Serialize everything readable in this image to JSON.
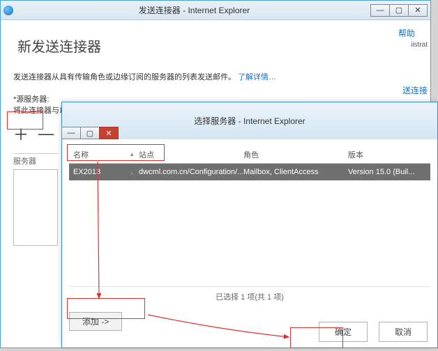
{
  "back_window": {
    "title": "发送连接器 - Internet Explorer",
    "help": "帮助",
    "page_title": "新发送连接器",
    "description_prefix": "发送连接器从具有传输角色或边缘订阅的服务器的列表发送邮件。",
    "learn_more": "了解详情…",
    "source_label": "*源服务器:",
    "source_hint": "将此连接器与以下包含传输角色的服务器关联。也可以向此列表添加边缘订阅。",
    "plus": "＋",
    "minus": "—",
    "col_server": "服务器",
    "right_text": "iistrat",
    "right_link": "送连接"
  },
  "front_window": {
    "title": "选择服务器 - Internet Explorer",
    "columns": {
      "name": "名称",
      "site": "站点",
      "role": "角色",
      "version": "版本"
    },
    "row": {
      "name": "EX2013",
      "site": "dwcml.com.cn/Configuration/...",
      "role": "Mailbox, ClientAccess",
      "version": "Version 15.0 (Buil..."
    },
    "footer": "已选择 1 项(共 1 项)",
    "add": "添加 ->",
    "ok": "确定",
    "cancel": "取消"
  },
  "win_controls": {
    "min": "—",
    "max": "▢",
    "close": "✕"
  }
}
